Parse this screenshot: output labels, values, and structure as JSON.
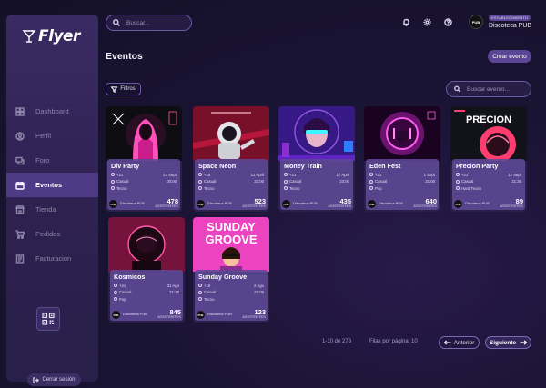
{
  "brand": {
    "name": "Flyer"
  },
  "colors": {
    "accent": "#5b4597",
    "sidebar": "#2e2150",
    "card_panel": "#5f4896",
    "background": "#1a1434"
  },
  "search": {
    "placeholder": "Buscar..."
  },
  "header_icons": [
    "bell-icon",
    "gear-icon",
    "help-icon"
  ],
  "user": {
    "badge": "ESTABLECIMIENTO",
    "name": "Discoteca PUB",
    "avatar_text": "PUB"
  },
  "sidebar": {
    "items": [
      {
        "label": "Dashboard",
        "icon": "dashboard-icon",
        "active": false
      },
      {
        "label": "Perfil",
        "icon": "profile-icon",
        "active": false
      },
      {
        "label": "Foro",
        "icon": "forum-icon",
        "active": false
      },
      {
        "label": "Eventos",
        "icon": "events-icon",
        "active": true
      },
      {
        "label": "Tienda",
        "icon": "store-icon",
        "active": false
      },
      {
        "label": "Pedidos",
        "icon": "cart-icon",
        "active": false
      },
      {
        "label": "Facturacion",
        "icon": "billing-icon",
        "active": false
      }
    ],
    "logout_label": "Cerrar sesión"
  },
  "main": {
    "title": "Eventos",
    "create_label": "Crear evento",
    "filter_label": "Filtros",
    "event_search_placeholder": "Buscar evento..."
  },
  "events": [
    {
      "title": "Div Party",
      "age": "+21",
      "date": "23 Sept",
      "dress": "Casual",
      "time": "00:00",
      "music": "Tecno",
      "venue": "Discoteca PUB",
      "attendees": "478",
      "att_label": "ASISTENTES",
      "poster": "pink-hood"
    },
    {
      "title": "Space Neon",
      "age": "+18",
      "date": "12 April",
      "dress": "Casual",
      "time": "22:00",
      "music": "Tecno",
      "venue": "Discoteca PUB",
      "attendees": "523",
      "att_label": "ASISTENTES",
      "poster": "astronaut"
    },
    {
      "title": "Money Train",
      "age": "+21",
      "date": "17 April",
      "dress": "Casual",
      "time": "23:00",
      "music": "Tecno",
      "venue": "Discoteca PUB",
      "attendees": "435",
      "att_label": "ASISTENTES",
      "poster": "cyber-girl"
    },
    {
      "title": "Eden Fest",
      "age": "+21",
      "date": "1 Sept",
      "dress": "Casual",
      "time": "21:00",
      "music": "Pop",
      "venue": "Discoteca PUB",
      "attendees": "640",
      "att_label": "ASISTENTES",
      "poster": "neon-orb"
    },
    {
      "title": "Precion Party",
      "age": "+21",
      "date": "12 Sept",
      "dress": "Casual",
      "time": "21:30",
      "music": "Hard Tecno",
      "venue": "Discoteca PUB",
      "attendees": "89",
      "att_label": "ASISTENTES",
      "poster": "precion"
    },
    {
      "title": "Kosmicos",
      "age": "+21",
      "date": "31 Ago",
      "dress": "Casual",
      "time": "21:30",
      "music": "Pop",
      "venue": "Discoteca PUB",
      "attendees": "845",
      "att_label": "ASISTENTES",
      "poster": "helmet"
    },
    {
      "title": "Sunday Groove",
      "age": "+18",
      "date": "2 Ago",
      "dress": "Casual",
      "time": "21:00",
      "music": "Tecno",
      "venue": "Discoteca PUB",
      "attendees": "123",
      "att_label": "ASISTENTES",
      "poster": "sunday"
    }
  ],
  "poster_text": {
    "precion_word": "PRECION",
    "sunday_word": "SUNDAY",
    "groove_word": "GROOVE"
  },
  "pagination": {
    "range": "1-10 de 276",
    "per_page": "Filas por página: 10",
    "prev_label": "Anterior",
    "next_label": "Siguiente"
  }
}
